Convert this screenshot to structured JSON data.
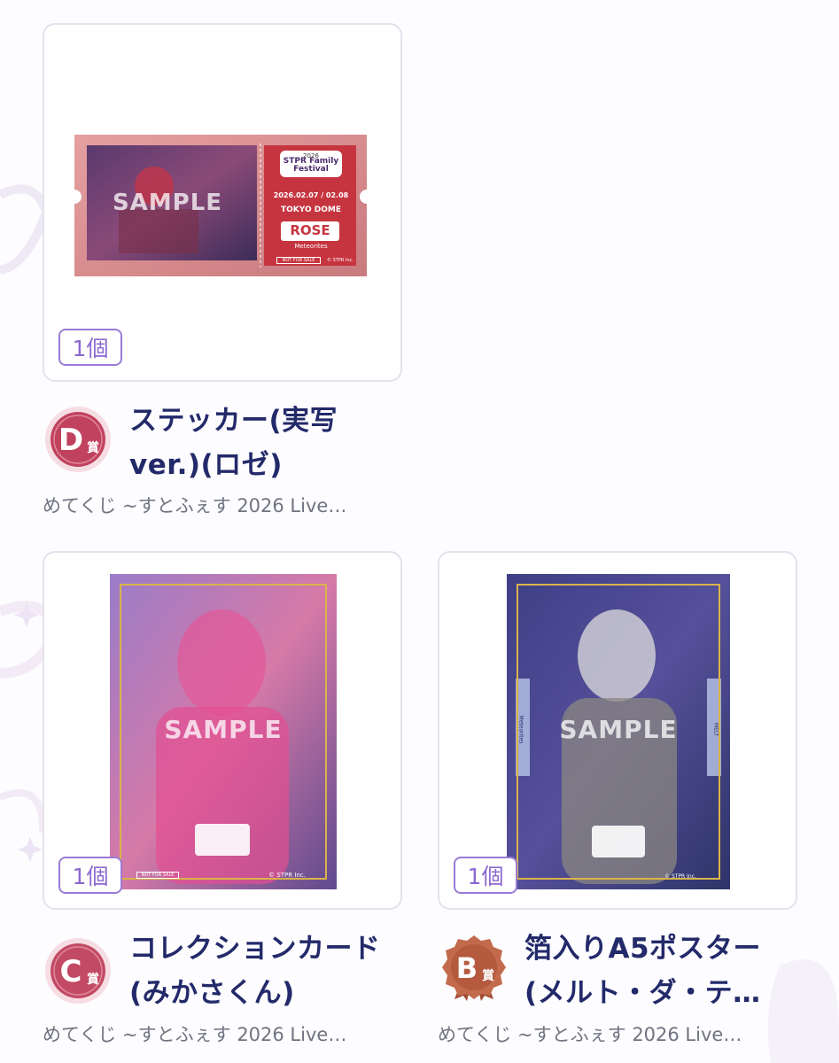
{
  "colors": {
    "accent": "#8a68cf",
    "title": "#232a6a",
    "subtitle": "#707480",
    "card_border": "#e4e2ec",
    "d_badge": "#c0425e",
    "c_badge": "#c24a64",
    "b_badge": "#b55a3e"
  },
  "items": [
    {
      "rank_letter": "D",
      "rank_suffix": "賞",
      "qty": "1個",
      "title_lines": [
        "ステッカー(実写",
        "ver.)(ロゼ)"
      ],
      "series": "めてくじ ~すとふぇす 2026 Live…",
      "image": {
        "kind": "ticket-sticker",
        "sample": "SAMPLE",
        "year": "2026",
        "logo": [
          "STPR",
          "Family",
          "Festival"
        ],
        "dates": "2026.02.07 / 02.08",
        "venue": "TOKYO DOME",
        "name": "ROSE",
        "group": "Meteorites",
        "nfs": "NOT FOR SALE",
        "copyright": "© STPR Inc."
      }
    },
    {
      "rank_letter": "C",
      "rank_suffix": "賞",
      "qty": "1個",
      "title_lines": [
        "コレクションカード",
        "(みかさくん)"
      ],
      "series": "めてくじ ~すとふぇす 2026 Live…",
      "image": {
        "kind": "collection-card",
        "sample": "SAMPLE",
        "nfs": "NOT FOR SALE",
        "copyright": "© STPR Inc."
      }
    },
    {
      "rank_letter": "B",
      "rank_suffix": "賞",
      "qty": "1個",
      "title_lines": [
        "箔入りA5ポスター",
        "(メルト・ダ・テ…"
      ],
      "series": "めてくじ ~すとふぇす 2026 Live…",
      "image": {
        "kind": "a5-poster",
        "sample": "SAMPLE",
        "side_left": "Meteorites",
        "side_right": "MELT",
        "copyright": "© STPR Inc."
      }
    }
  ]
}
